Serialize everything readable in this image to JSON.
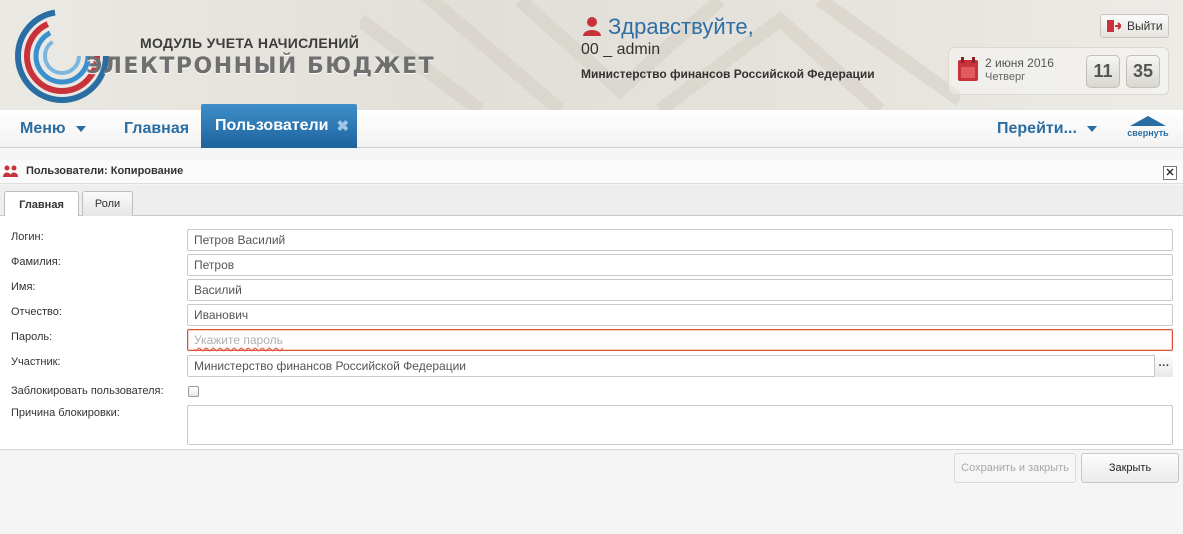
{
  "header": {
    "module_name": "МОДУЛЬ УЧЕТА НАЧИСЛЕНИЙ",
    "product_name": "ЭЛЕКТРОННЫЙ БЮДЖЕТ",
    "greeting": "Здравствуйте,",
    "username": "00 _ admin",
    "organization": "Министерство финансов Российской Федерации",
    "logout_label": "Выйти",
    "date": "2 июня 2016",
    "weekday": "Четверг",
    "clock": {
      "hours": "11",
      "minutes": "35"
    }
  },
  "nav": {
    "menu_label": "Меню",
    "home_label": "Главная",
    "active_tab_label": "Пользователи",
    "goto_label": "Перейти...",
    "collapse_label": "свернуть"
  },
  "window": {
    "title": "Пользователи: Копирование",
    "close_glyph": "✕",
    "tabs": [
      {
        "label": "Главная",
        "active": true
      },
      {
        "label": "Роли",
        "active": false
      }
    ]
  },
  "form": {
    "login": {
      "label": "Логин:",
      "value": "Петров Василий"
    },
    "surname": {
      "label": "Фамилия:",
      "value": "Петров"
    },
    "name": {
      "label": "Имя:",
      "value": "Василий"
    },
    "patronymic": {
      "label": "Отчество:",
      "value": "Иванович"
    },
    "password": {
      "label": "Пароль:",
      "value": "",
      "placeholder": "Укажите пароль"
    },
    "participant": {
      "label": "Участник:",
      "value": "Министерство финансов Российской Федерации",
      "lookup_glyph": "···"
    },
    "block_user": {
      "label": "Заблокировать пользователя:",
      "checked": false
    },
    "block_reason": {
      "label": "Причина блокировки:",
      "value": ""
    }
  },
  "buttons": {
    "save_close": "Сохранить и закрыть",
    "close": "Закрыть"
  },
  "colors": {
    "accent_blue": "#2a6da3",
    "active_tab": "#1d639e",
    "error_border": "#d9533b",
    "calendar_red": "#c8323a"
  }
}
